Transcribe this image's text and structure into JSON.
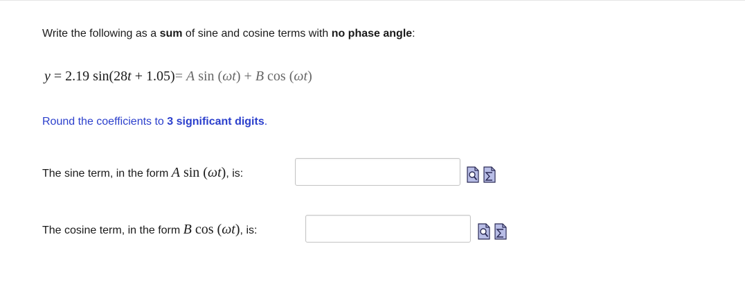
{
  "instruction": {
    "part1": "Write the following as a ",
    "bold1": "sum",
    "part2": " of sine and cosine terms with ",
    "bold2": "no phase angle",
    "part3": ":"
  },
  "equation": {
    "lhs_var": "y",
    "eq": " = ",
    "amp": "2.19",
    "func": " sin(28",
    "t": "t",
    "plus": " + ",
    "phase": "1.05)",
    "eq2": "= ",
    "A": "A",
    "sin": "  sin (",
    "wt1": "ωt",
    "close1": ") + ",
    "B": "B",
    "cos": "  cos (",
    "wt2": "ωt",
    "close2": ")"
  },
  "round_note": {
    "part1": "Round the coefficients to ",
    "bold": "3 significant digits",
    "part2": "."
  },
  "sine_row": {
    "prefix": "The sine term, in the form ",
    "A": "A",
    "func": "  sin (",
    "wt": "ωt",
    "close": ")",
    "suffix": ", is:",
    "value": ""
  },
  "cosine_row": {
    "prefix": "The cosine term, in the form ",
    "B": "B",
    "func": "  cos (",
    "wt": "ωt",
    "close": ")",
    "suffix": ", is:",
    "value": ""
  },
  "icons": {
    "preview": "magnify-preview-icon",
    "formula": "sigma-formula-icon"
  },
  "colors": {
    "link_blue": "#2b3fcc",
    "icon_fill": "#b8bde6",
    "icon_stroke": "#2a2a55"
  }
}
